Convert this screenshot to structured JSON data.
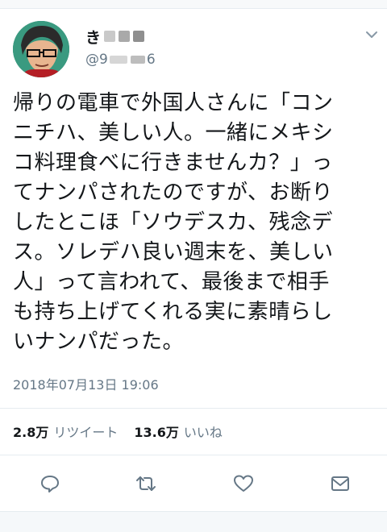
{
  "user": {
    "name_visible": "き",
    "handle_prefix": "@9",
    "handle_suffix": "6"
  },
  "tweet": {
    "lines": [
      "帰りの電車で外国人さんに「コン",
      "ニチハ、美しい人。一緒にメキシ",
      "コ料理食べに行きませんカ？」っ",
      "てナンパされたのですが、お断り",
      "したとこほ「ソウデスカ、残念デ",
      "ス。ソレデハ良い週末を、美しい",
      "人」って言われて、最後まで相手",
      "も持ち上げてくれる実に素晴らし",
      "いナンパだった。"
    ]
  },
  "timestamp": "2018年07月13日 19:06",
  "stats": {
    "retweets_count": "2.8万",
    "retweets_label": "リツイート",
    "likes_count": "13.6万",
    "likes_label": "いいね"
  },
  "icons": {
    "reply": "reply-icon",
    "retweet": "retweet-icon",
    "like": "heart-icon",
    "dm": "envelope-icon",
    "more": "chevron-down-icon"
  },
  "colors": {
    "text": "#14171a",
    "secondary": "#657786",
    "icon": "#657786",
    "divider": "#e6ecf0"
  }
}
